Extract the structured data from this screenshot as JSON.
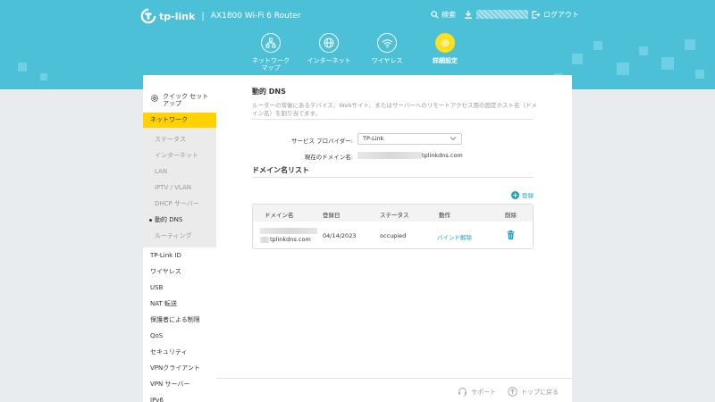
{
  "header": {
    "brand": "tp-link",
    "model": "AX1800 Wi-Fi 6 Router",
    "search_label": "検索",
    "logout_label": "ログアウト"
  },
  "nav_tabs": [
    {
      "label": "ネットワーク\nマップ",
      "icon": "network-map-icon"
    },
    {
      "label": "インターネット",
      "icon": "globe-icon"
    },
    {
      "label": "ワイヤレス",
      "icon": "wifi-icon"
    },
    {
      "label": "詳細設定",
      "icon": "gear-icon",
      "active": true
    }
  ],
  "sidebar": {
    "quick_setup": "クイック セット\nアップ",
    "network": "ネットワーク",
    "network_sub": [
      "ステータス",
      "インターネット",
      "LAN",
      "IPTV / VLAN",
      "DHCP サーバー",
      "動的 DNS",
      "ルーティング"
    ],
    "current_sub": "動的 DNS",
    "items": [
      "TP-Link ID",
      "ワイヤレス",
      "USB",
      "NAT 転送",
      "保護者による制限",
      "QoS",
      "セキュリティ",
      "VPNクライアント",
      "VPN サーバー",
      "IPv6"
    ]
  },
  "main": {
    "title": "動的 DNS",
    "description": "ルーターの背後にあるデバイス、Webサイト、またはサーバーへのリモートアクセス用の固定ホスト名（ドメイン名）を割り当てます。",
    "provider_label": "サービス プロバイダー:",
    "provider_value": "TP-Link",
    "current_domain_label": "現在のドメイン名:",
    "current_domain_suffix": "tplinkdns.com",
    "list_title": "ドメイン名リスト",
    "add_label": "登録",
    "table": {
      "headers": [
        "ドメイン名",
        "登録日",
        "ステータス",
        "動作",
        "削除"
      ],
      "rows": [
        {
          "domain": "tplinkdns.com",
          "date": "04/14/2023",
          "status": "occupied",
          "action": "バインド解除"
        }
      ]
    }
  },
  "footer": {
    "support": "サポート",
    "top": "トップに戻る"
  },
  "colors": {
    "header_bg": "#4cc0d7",
    "accent_yellow": "#ffd200",
    "link_blue": "#1aa3c9"
  }
}
